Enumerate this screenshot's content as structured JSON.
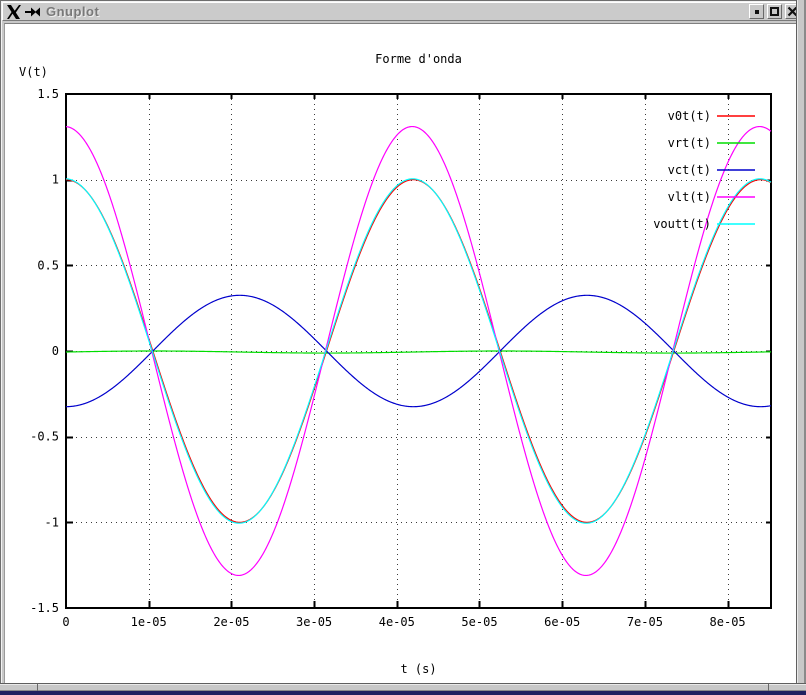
{
  "window": {
    "title": "Gnuplot",
    "titlebar_icons": [
      "x11-logo",
      "pushpin"
    ],
    "buttons": [
      {
        "name": "iconify",
        "glyph": "small-filled-square"
      },
      {
        "name": "maximize",
        "glyph": "hollow-square"
      },
      {
        "name": "close",
        "glyph": "x-cross"
      }
    ],
    "colors": {
      "titlebar_bg": "#cbcbcb",
      "frame_bg": "#c8c8c8",
      "client_bg": "#ffffff",
      "title_text": "#787878",
      "desktop_strip": "#202060"
    }
  },
  "chart_data": {
    "type": "line",
    "title": "Forme d'onda",
    "xlabel": "t (s)",
    "ylabel": "V(t)",
    "xlim": [
      0,
      8.525e-05
    ],
    "ylim": [
      -1.5,
      1.5
    ],
    "grid": true,
    "legend_position": "top-right",
    "x_ticks": [
      {
        "value": 0,
        "label": "0"
      },
      {
        "value": 1e-05,
        "label": "1e-05"
      },
      {
        "value": 2e-05,
        "label": "2e-05"
      },
      {
        "value": 3e-05,
        "label": "3e-05"
      },
      {
        "value": 4e-05,
        "label": "4e-05"
      },
      {
        "value": 5e-05,
        "label": "5e-05"
      },
      {
        "value": 6e-05,
        "label": "6e-05"
      },
      {
        "value": 7e-05,
        "label": "7e-05"
      },
      {
        "value": 8e-05,
        "label": "8e-05"
      }
    ],
    "y_ticks": [
      {
        "value": 1.5,
        "label": "1.5"
      },
      {
        "value": 1,
        "label": "1"
      },
      {
        "value": 0.5,
        "label": "0.5"
      },
      {
        "value": 0,
        "label": "0"
      },
      {
        "value": -0.5,
        "label": "-0.5"
      },
      {
        "value": -1,
        "label": "-1"
      },
      {
        "value": -1.5,
        "label": "-1.5"
      }
    ],
    "series": [
      {
        "name": "v0t(t)",
        "color": "#ff0000",
        "waveform": "cosine",
        "amplitude": 1.0,
        "period_s": 4.2e-05,
        "phase_rad": 0,
        "offset": 0
      },
      {
        "name": "vrt(t)",
        "color": "#00dd00",
        "waveform": "cosine",
        "amplitude": 0.006,
        "period_s": 4.2e-05,
        "phase_rad": -1.571,
        "offset": -0.006
      },
      {
        "name": "vct(t)",
        "color": "#0000cc",
        "waveform": "cosine",
        "amplitude": 0.325,
        "period_s": 4.2e-05,
        "phase_rad": 3.1416,
        "offset": 0
      },
      {
        "name": "vlt(t)",
        "color": "#ff00ff",
        "waveform": "cosine",
        "amplitude": 1.31,
        "period_s": 4.2e-05,
        "phase_rad": 0.02,
        "offset": 0
      },
      {
        "name": "voutt(t)",
        "color": "#00ffff",
        "waveform": "cosine",
        "amplitude": 1.005,
        "period_s": 4.2e-05,
        "phase_rad": 0.012,
        "offset": 0
      }
    ]
  }
}
